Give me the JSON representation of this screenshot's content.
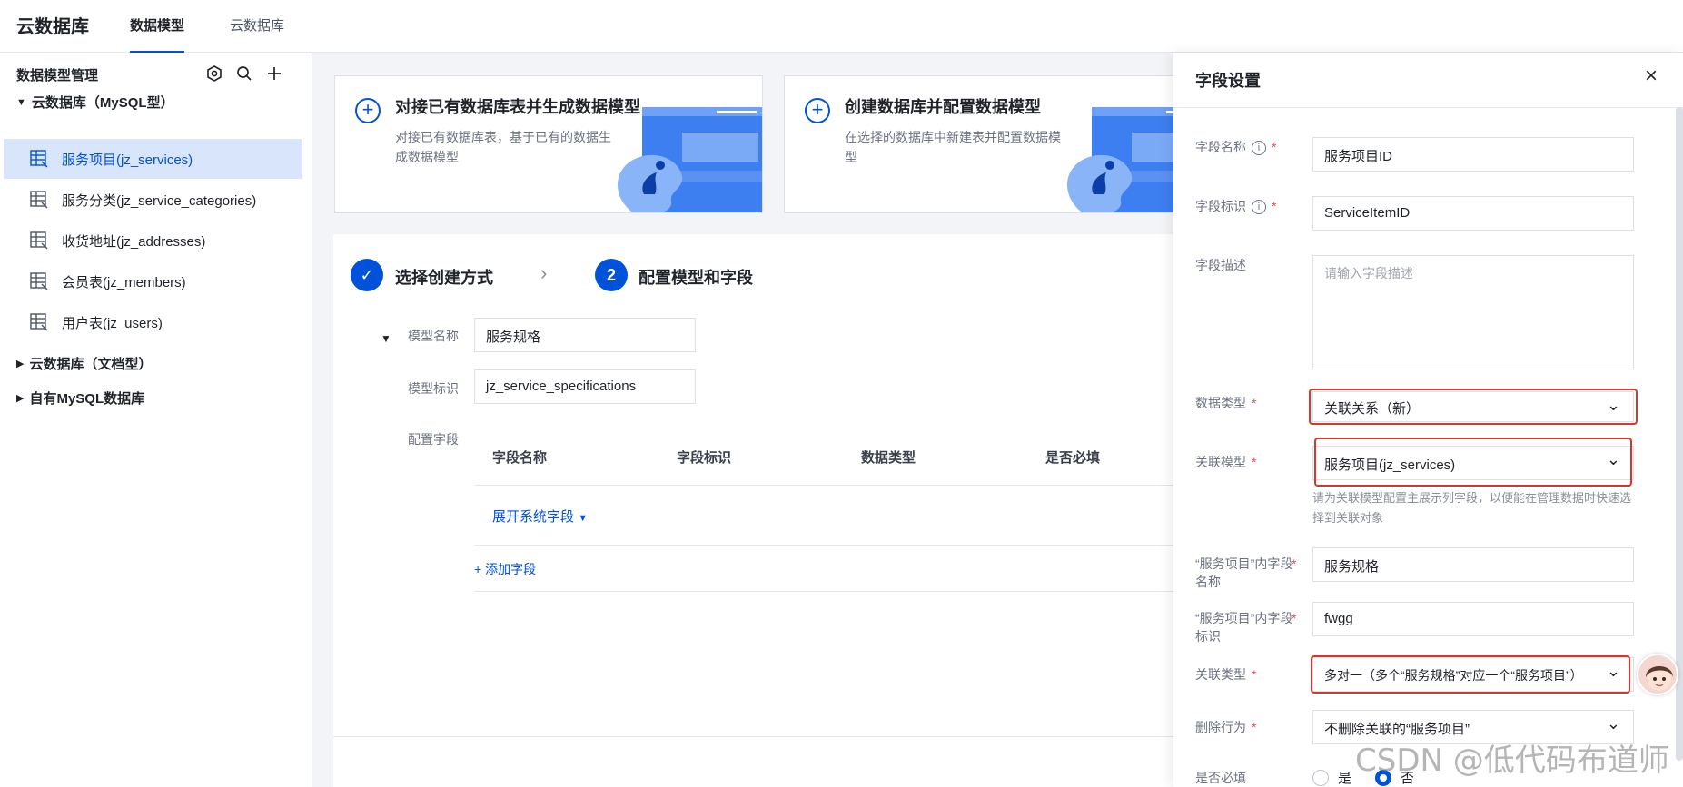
{
  "app": {
    "brand": "云数据库"
  },
  "nav": {
    "tabs": [
      {
        "label": "数据模型",
        "active": true
      },
      {
        "label": "云数据库",
        "active": false
      }
    ]
  },
  "sidebar": {
    "title": "数据模型管理",
    "groups": [
      {
        "label": "云数据库（MySQL型）",
        "expanded": true
      },
      {
        "label": "云数据库（文档型）",
        "expanded": false
      },
      {
        "label": "自有MySQL数据库",
        "expanded": false
      }
    ],
    "tables": [
      {
        "label": "服务项目(jz_services)",
        "active": true
      },
      {
        "label": "服务分类(jz_service_categories)",
        "active": false
      },
      {
        "label": "收货地址(jz_addresses)",
        "active": false
      },
      {
        "label": "会员表(jz_members)",
        "active": false
      },
      {
        "label": "用户表(jz_users)",
        "active": false
      }
    ]
  },
  "cards": [
    {
      "title": "对接已有数据库表并生成数据模型",
      "desc": "对接已有数据库表，基于已有的数据生成数据模型"
    },
    {
      "title": "创建数据库并配置数据模型",
      "desc": "在选择的数据库中新建表并配置数据模型"
    }
  ],
  "steps": [
    {
      "number": "✓",
      "label": "选择创建方式"
    },
    {
      "number": "2",
      "label": "配置模型和字段"
    }
  ],
  "form": {
    "model_name_label": "模型名称",
    "model_name_value": "服务规格",
    "model_id_label": "模型标识",
    "model_id_value": "jz_service_specifications",
    "fields_label": "配置字段",
    "table_headers": [
      "字段名称",
      "字段标识",
      "数据类型",
      "是否必填"
    ],
    "expand_system": "展开系统字段",
    "add_field": "+ 添加字段"
  },
  "drawer": {
    "title": "字段设置",
    "close": "×",
    "field_name_label": "字段名称",
    "field_name_value": "服务项目ID",
    "field_id_label": "字段标识",
    "field_id_value": "ServiceItemID",
    "field_desc_label": "字段描述",
    "field_desc_placeholder": "请输入字段描述",
    "data_type_label": "数据类型",
    "data_type_value": "关联关系（新）",
    "rel_model_label": "关联模型",
    "rel_model_value": "服务项目(jz_services)",
    "rel_model_hint": "请为关联模型配置主展示列字段，以便能在管理数据时快速选择到关联对象",
    "inner_name_label": "“服务项目”内字段名称",
    "inner_name_value": "服务规格",
    "inner_id_label": "“服务项目”内字段标识",
    "inner_id_value": "fwgg",
    "rel_type_label": "关联类型",
    "rel_type_value": "多对一（多个“服务规格”对应一个“服务项目”）",
    "delete_label": "删除行为",
    "delete_value": "不删除关联的“服务项目”",
    "required_label": "是否必填",
    "required_yes": "是",
    "required_no": "否",
    "required_selected": "否"
  },
  "watermark": "CSDN @低代码布道师",
  "colors": {
    "accent": "#0052d9",
    "highlight": "#d9362b",
    "required": "#e34d59"
  }
}
